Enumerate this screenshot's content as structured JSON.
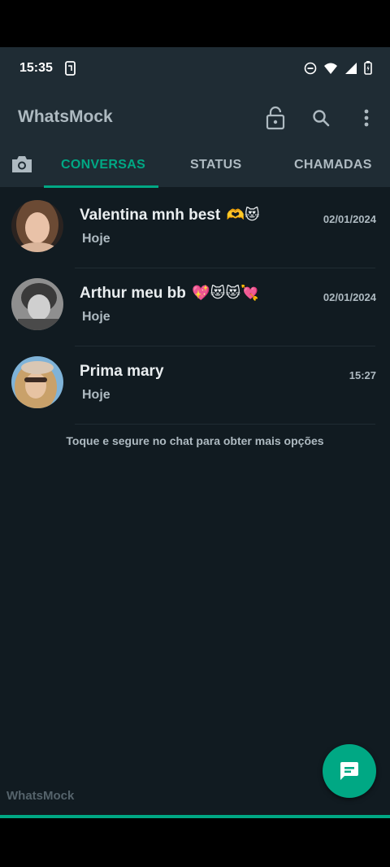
{
  "status_bar": {
    "time": "15:35"
  },
  "app_bar": {
    "title": "WhatsMock",
    "icons": [
      "lock-open-icon",
      "search-icon",
      "more-vert-icon"
    ]
  },
  "tabs": [
    {
      "label": "CONVERSAS",
      "active": true
    },
    {
      "label": "STATUS",
      "active": false
    },
    {
      "label": "CHAMADAS",
      "active": false
    }
  ],
  "chats": [
    {
      "name": "Valentina mnh best",
      "emoji": "🫶😻",
      "subtitle": "Hoje",
      "time": "02/01/2024"
    },
    {
      "name": "Arthur meu bb",
      "emoji": "💖😻😻💘",
      "subtitle": "Hoje",
      "time": "02/01/2024"
    },
    {
      "name": "Prima mary",
      "emoji": "",
      "subtitle": "Hoje",
      "time": "15:27"
    }
  ],
  "hint": "Toque e segure no chat para obter mais opções",
  "watermark": "WhatsMock",
  "colors": {
    "accent": "#00a884",
    "background": "#111b21",
    "appbar": "#1f2c34"
  }
}
